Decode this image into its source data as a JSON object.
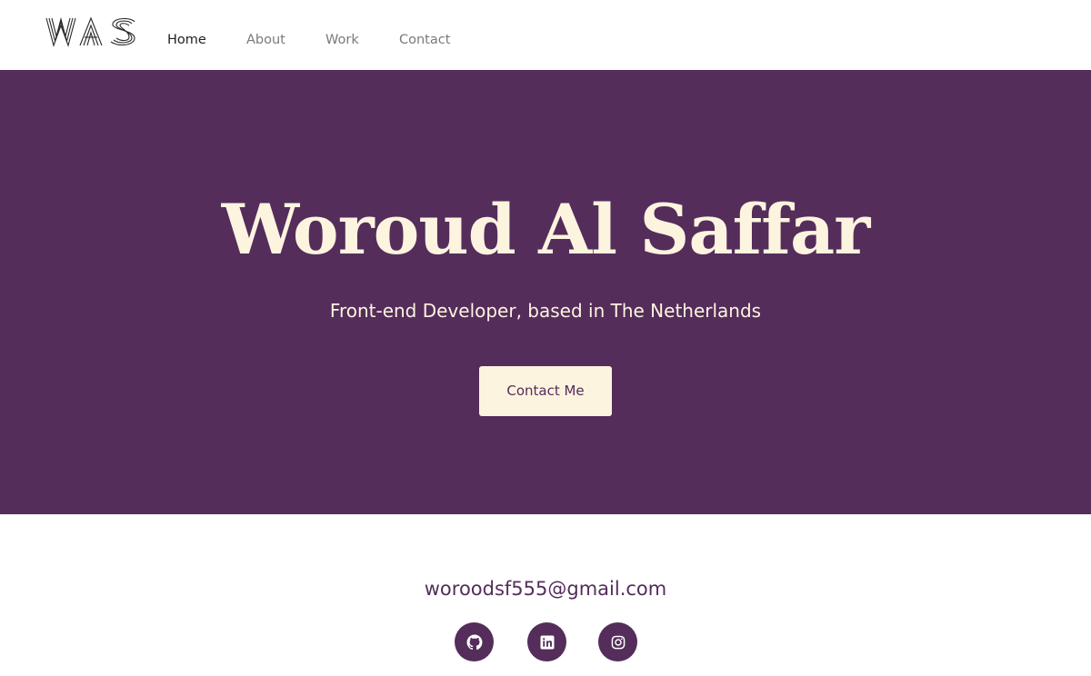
{
  "header": {
    "logo_text": "WAS",
    "nav": {
      "home": "Home",
      "about": "About",
      "work": "Work",
      "contact": "Contact"
    }
  },
  "hero": {
    "title": "Woroud Al Saffar",
    "subtitle": "Front-end Developer, based in The Netherlands",
    "cta_label": "Contact Me"
  },
  "footer": {
    "email": "woroodsf555@gmail.com",
    "socials": [
      "github-icon",
      "linkedin-icon",
      "instagram-icon"
    ]
  },
  "colors": {
    "brand_purple": "#542d5b",
    "cream": "#fdf4df",
    "nav_inactive": "#7a7a7a",
    "nav_active": "#222222"
  }
}
